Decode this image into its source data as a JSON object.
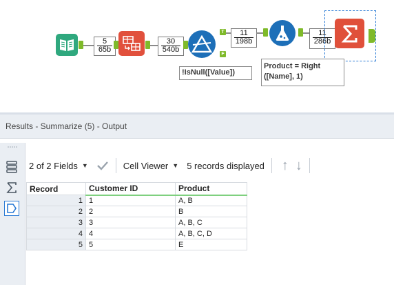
{
  "workflow": {
    "connections": [
      {
        "count": "5",
        "size": "65b"
      },
      {
        "count": "30",
        "size": "540b"
      },
      {
        "count": "11",
        "size": "198b"
      },
      {
        "count": "11",
        "size": "286b"
      }
    ],
    "filter_annotation": "!IsNull([Value])",
    "formula_annotation_line1": "Product = Right",
    "formula_annotation_line2": "([Name], 1)",
    "filter_true_label": "T",
    "filter_false_label": "F",
    "colors": {
      "input_tool": "#2fa87e",
      "transform_tool": "#e1503c",
      "filter_tool": "#1d6fb8",
      "formula_tool": "#1d6fb8",
      "summarize_tool": "#e0503a",
      "anchor": "#7fba2a",
      "selection": "#2b7bd5"
    }
  },
  "results": {
    "header": "Results - Summarize (5) - Output",
    "fields_label": "2 of 2 Fields",
    "cell_viewer_label": "Cell Viewer",
    "records_label": "5 records displayed",
    "columns": [
      "Record",
      "Customer ID",
      "Product"
    ],
    "rows": [
      {
        "record": "1",
        "customer_id": "1",
        "product": "A, B"
      },
      {
        "record": "2",
        "customer_id": "2",
        "product": "B"
      },
      {
        "record": "3",
        "customer_id": "3",
        "product": "A, B, C"
      },
      {
        "record": "4",
        "customer_id": "4",
        "product": "A, B, C, D"
      },
      {
        "record": "5",
        "customer_id": "5",
        "product": "E"
      }
    ]
  }
}
